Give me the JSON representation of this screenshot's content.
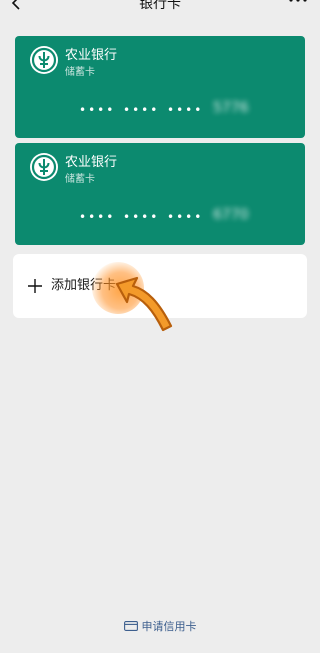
{
  "header": {
    "title": "银行卡"
  },
  "cards": [
    {
      "bank": "农业银行",
      "type": "储蓄卡",
      "mask1": "••••",
      "mask2": "••••",
      "mask3": "••••",
      "tail": "5776"
    },
    {
      "bank": "农业银行",
      "type": "储蓄卡",
      "mask1": "••••",
      "mask2": "••••",
      "mask3": "••••",
      "tail": "6770"
    }
  ],
  "add_card": {
    "label": "添加银行卡"
  },
  "footer": {
    "link_label": "申请信用卡"
  },
  "colors": {
    "card_green": "#0c8a6f",
    "page_bg": "#ededed",
    "link_blue": "#3d5f8e",
    "highlight_orange": "#f39a2a"
  }
}
